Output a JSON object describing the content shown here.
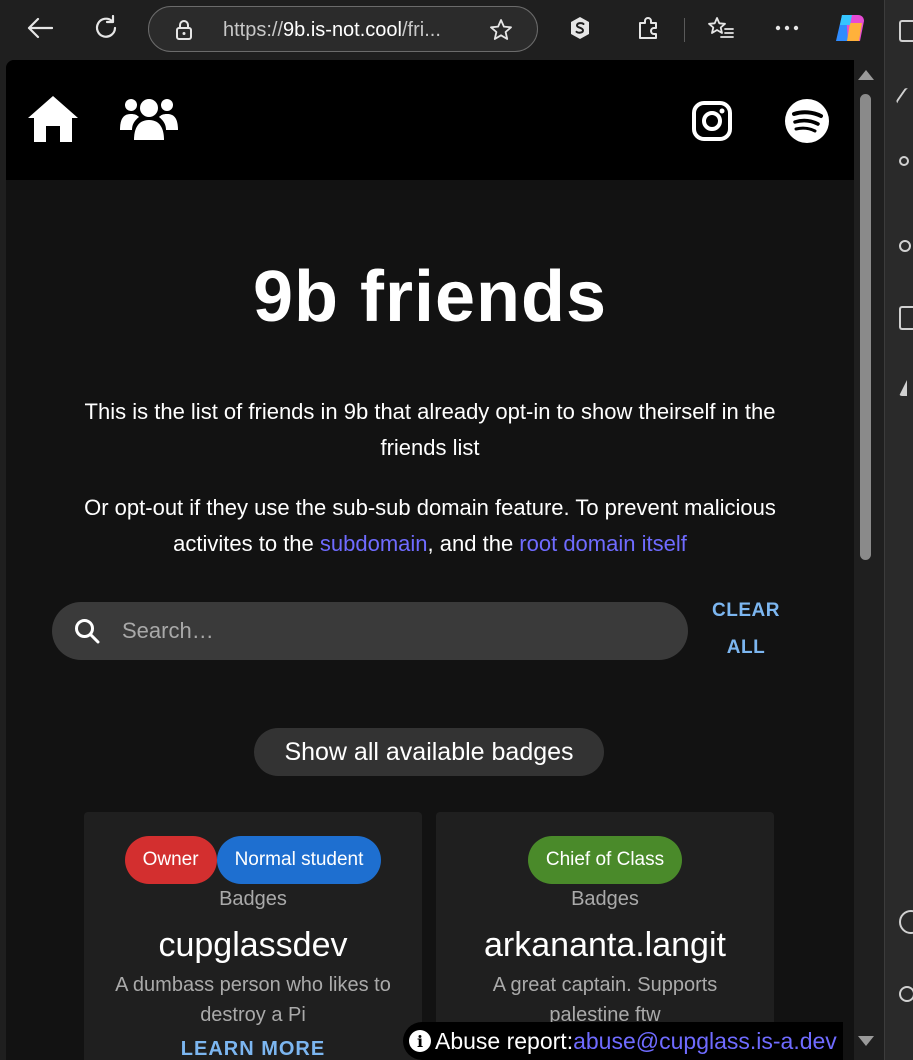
{
  "browser": {
    "url_prefix": "https://",
    "url_host": "9b.is-not.cool",
    "url_rest": "/fri..."
  },
  "header": {
    "icons": [
      "home-icon",
      "friends-icon",
      "instagram-icon",
      "spotify-icon"
    ]
  },
  "main": {
    "title": "9b friends",
    "intro": "This is the list of friends in 9b that already opt-in to show theirself in the friends list",
    "optout_text_1": "Or opt-out if they use the sub-sub domain feature. To prevent malicious activites to the ",
    "optout_link_1": "subdomain",
    "optout_text_2": ", and the ",
    "optout_link_2": "root domain itself"
  },
  "search": {
    "placeholder": "Search…",
    "value": "",
    "clear_label_line1": "CLEAR",
    "clear_label_line2": "ALL"
  },
  "badges_button": "Show all available badges",
  "cards": [
    {
      "badges": [
        {
          "label": "Owner",
          "color": "#d32f2f"
        },
        {
          "label": "Normal student",
          "color": "#1e6fd0"
        }
      ],
      "badges_label": "Badges",
      "name": "cupglassdev",
      "description": "A dumbass person who likes to destroy a Pi",
      "link": "LEARN MORE"
    },
    {
      "badges": [
        {
          "label": "Chief of Class",
          "color": "#4a8a2a"
        }
      ],
      "badges_label": "Badges",
      "name": "arkananta.langit",
      "description": "A great captain. Supports palestine ftw"
    }
  ],
  "footer": {
    "abuse_label": "Abuse report:",
    "abuse_email": "abuse@cupglass.is-a.dev"
  },
  "colors": {
    "accent_link": "#6f6bff",
    "accent_button": "#7cb6f0",
    "background": "#121212"
  }
}
